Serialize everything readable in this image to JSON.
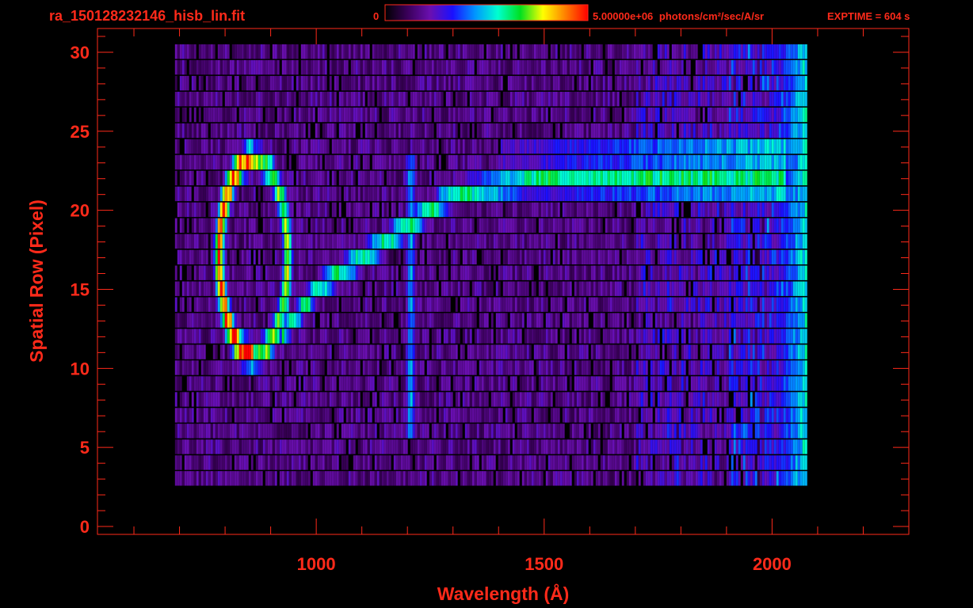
{
  "header": {
    "filename": "ra_150128232146_hisb_lin.fit",
    "colorbar_min": "0",
    "colorbar_max": "5.00000e+06",
    "colorbar_unit": "photons/cm²/sec/A/sr",
    "exptime": "EXPTIME = 604 s"
  },
  "colors": {
    "label": "#ff2a1a",
    "background": "#000000",
    "colormap": [
      "#000000",
      "#3a005a",
      "#6a0fb0",
      "#1a10ff",
      "#0096ff",
      "#00ffd0",
      "#00e020",
      "#ffff00",
      "#ff8000",
      "#ff0000"
    ]
  },
  "chart_data": {
    "type": "heatmap",
    "xlabel": "Wavelength (Å)",
    "ylabel": "Spatial Row (Pixel)",
    "xlim": [
      520,
      2300
    ],
    "ylim": [
      -0.5,
      31.5
    ],
    "x_ticks": [
      1000,
      1500,
      2000
    ],
    "x_tick_labels": [
      "1000",
      "1500",
      "2000"
    ],
    "y_ticks": [
      0,
      5,
      10,
      15,
      20,
      25,
      30
    ],
    "y_tick_labels": [
      "0",
      "5",
      "10",
      "15",
      "20",
      "25",
      "30"
    ],
    "x_minor_step": 100,
    "y_minor_step": 1,
    "data_extent": {
      "x": [
        690,
        2075
      ],
      "rows": [
        3,
        30
      ]
    },
    "colorbar_range": [
      0,
      5000000
    ],
    "features": [
      {
        "kind": "ring",
        "center": {
          "x": 860,
          "row": 17
        },
        "radius_x": 75,
        "radius_row": 6.2,
        "peak": 0.95
      },
      {
        "kind": "line",
        "points": [
          {
            "x": 920,
            "row": 12
          },
          {
            "x": 1000,
            "row": 15
          },
          {
            "x": 1100,
            "row": 17
          },
          {
            "x": 1200,
            "row": 19
          },
          {
            "x": 1300,
            "row": 21
          },
          {
            "x": 1500,
            "row": 22
          },
          {
            "x": 1800,
            "row": 22
          },
          {
            "x": 2030,
            "row": 22
          }
        ],
        "peak": 0.6
      },
      {
        "kind": "vertical",
        "x": 1205,
        "rows": [
          6,
          23
        ],
        "peak": 0.45
      },
      {
        "kind": "band",
        "x": [
          1400,
          2030
        ],
        "rows": [
          21,
          24
        ],
        "peak": 0.5
      },
      {
        "kind": "edge",
        "x": [
          1950,
          2075
        ],
        "rows": [
          1,
          30
        ],
        "peak": 0.55
      }
    ]
  }
}
